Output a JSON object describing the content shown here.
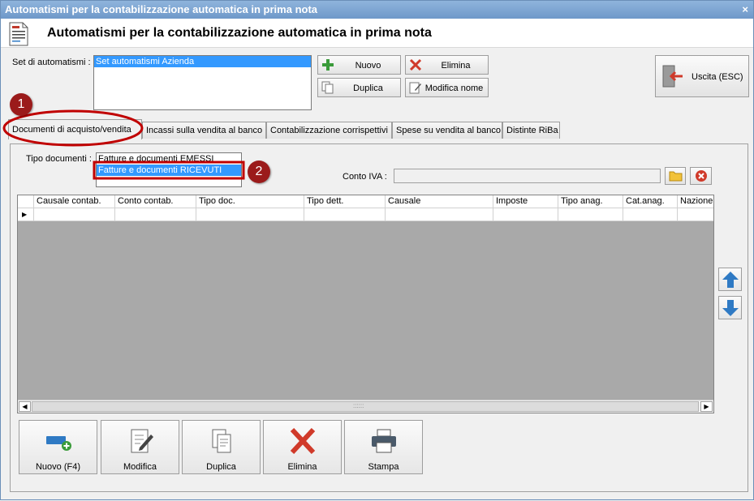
{
  "window": {
    "title": "Automatismi per la contabilizzazione automatica in prima nota",
    "close_glyph": "×"
  },
  "header": {
    "title": "Automatismi per la contabilizzazione automatica in prima nota",
    "icon": "document-icon"
  },
  "set": {
    "label": "Set di automatismi :",
    "items": [
      "Set automatismi Azienda"
    ],
    "selected_index": 0
  },
  "toolbar": {
    "nuovo": "Nuovo",
    "elimina": "Elimina",
    "duplica": "Duplica",
    "modifica_nome": "Modifica nome",
    "uscita": "Uscita (ESC)"
  },
  "tabs": [
    {
      "label": "Documenti di acquisto/vendita",
      "active": true
    },
    {
      "label": "Incassi sulla vendita al banco",
      "active": false
    },
    {
      "label": "Contabilizzazione corrispettivi",
      "active": false
    },
    {
      "label": "Spese su vendita al banco",
      "active": false
    },
    {
      "label": "Distinte RiBa",
      "active": false
    }
  ],
  "tipo_documenti": {
    "label": "Tipo documenti :",
    "items": [
      "Fatture e documenti EMESSI",
      "Fatture e documenti RICEVUTI"
    ],
    "selected_index": 1
  },
  "conto_iva": {
    "label": "Conto IVA :",
    "value": ""
  },
  "grid": {
    "columns": [
      "Causale contab.",
      "Conto contab.",
      "Tipo doc.",
      "Tipo dett.",
      "Causale",
      "Imposte",
      "Tipo anag.",
      "Cat.anag.",
      "Nazione"
    ],
    "row_marker": "▶",
    "scroll_grip": "::::::"
  },
  "bottom_buttons": {
    "nuovo": "Nuovo (F4)",
    "modifica": "Modifica",
    "duplica": "Duplica",
    "elimina": "Elimina",
    "stampa": "Stampa"
  },
  "annotations": {
    "marker1": "1",
    "marker2": "2"
  },
  "colors": {
    "title_bar": "#6e98c9",
    "selection": "#3399ff",
    "annotation_red": "#c00000",
    "add_green": "#3a9b3a",
    "delete_red": "#d03a2a",
    "arrow_blue": "#2f7ac4"
  }
}
